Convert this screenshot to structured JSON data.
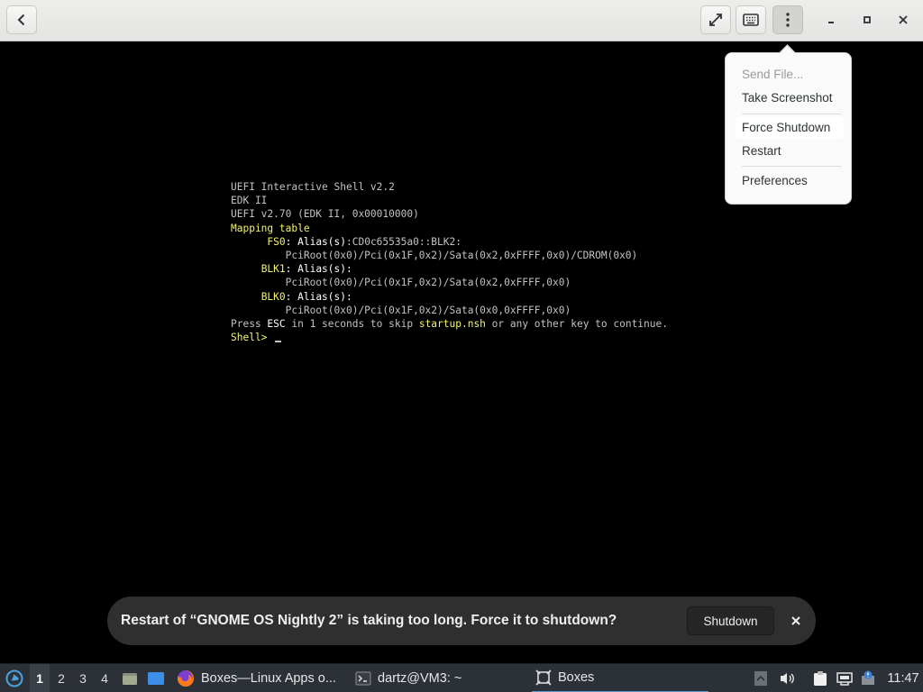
{
  "window": {
    "title_buttons": {
      "back": "back-icon",
      "fullscreen": "fullscreen-icon",
      "keyboard": "keyboard-icon",
      "menu": "view-more-icon",
      "minimize": "minimize-icon",
      "maximize": "maximize-icon",
      "close": "close-icon"
    }
  },
  "menu": {
    "items": [
      {
        "label": "Send File...",
        "enabled": false
      },
      {
        "label": "Take Screenshot",
        "enabled": true
      },
      {
        "label": "Force Shutdown",
        "enabled": true
      },
      {
        "label": "Restart",
        "enabled": true
      },
      {
        "label": "Preferences",
        "enabled": true
      }
    ]
  },
  "console": {
    "line1": "UEFI Interactive Shell v2.2",
    "line2": "EDK II",
    "line3": "UEFI v2.70 (EDK II, 0x00010000)",
    "line4": "Mapping table",
    "fs0_name": "FS0",
    "fs0_alias_label": ": Alias(s)",
    "fs0_alias_value": ":CD0c65535a0::BLK2:",
    "fs0_path": "PciRoot(0x0)/Pci(0x1F,0x2)/Sata(0x2,0xFFFF,0x0)/CDROM(0x0)",
    "blk1_name": "BLK1",
    "blk1_alias_label": ": Alias(s):",
    "blk1_path": "PciRoot(0x0)/Pci(0x1F,0x2)/Sata(0x2,0xFFFF,0x0)",
    "blk0_name": "BLK0",
    "blk0_alias_label": ": Alias(s):",
    "blk0_path": "PciRoot(0x0)/Pci(0x1F,0x2)/Sata(0x0,0xFFFF,0x0)",
    "press_pre": "Press ",
    "press_key": "ESC",
    "press_mid": " in 1 seconds to skip ",
    "press_file": "startup.nsh",
    "press_post": " or any other key to continue.",
    "prompt": "Shell>"
  },
  "notification": {
    "message": "Restart of “GNOME OS Nightly 2” is taking too long. Force it to shutdown?",
    "button_label": "Shutdown",
    "close_icon": "close-icon"
  },
  "taskbar": {
    "workspaces": [
      "1",
      "2",
      "3",
      "4"
    ],
    "active_workspace": "1",
    "tasks": [
      {
        "label": "Boxes—Linux Apps o...",
        "icon": "firefox-icon"
      },
      {
        "label": "dartz@VM3: ~",
        "icon": "terminal-icon"
      },
      {
        "label": "Boxes",
        "icon": "boxes-icon",
        "active": true
      }
    ],
    "clock": "11:47"
  },
  "colors": {
    "headerbar": "#e8e8e6",
    "console_text": "#c2c2c2",
    "console_highlight": "#f4f46a",
    "toast_bg": "#2f2f2f",
    "taskbar_bg": "#2c3137",
    "accent": "#5b9bd5"
  }
}
